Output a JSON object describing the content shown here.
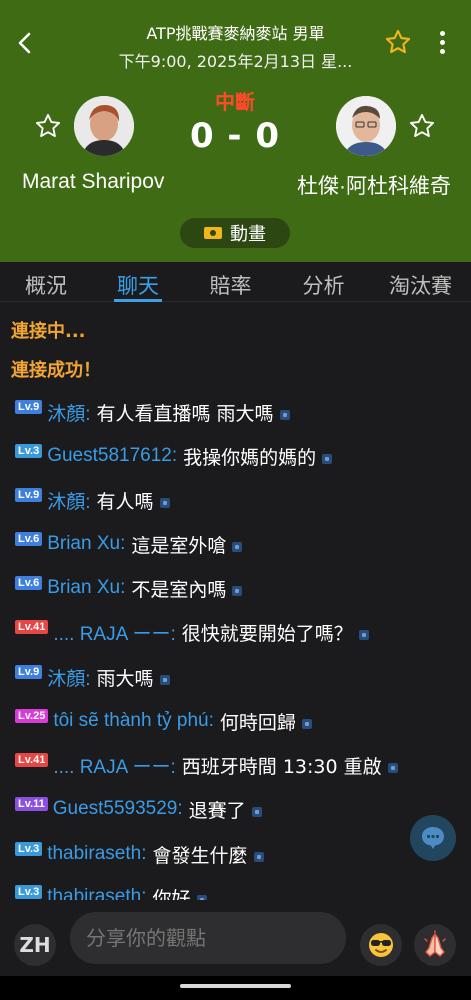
{
  "header": {
    "title": "ATP挑戰賽麥納麥站 男單",
    "subtitle": "下午9:00, 2025年2月13日 星...",
    "status": "中斷",
    "score": "0 - 0",
    "animation_label": "動畫",
    "home_player": "Marat Sharipov",
    "away_player": "杜傑·阿杜科維奇"
  },
  "tabs": [
    {
      "label": "概況"
    },
    {
      "label": "聊天"
    },
    {
      "label": "賠率"
    },
    {
      "label": "分析"
    },
    {
      "label": "淘汰賽"
    }
  ],
  "chat": {
    "system": [
      "連接中...",
      "連接成功！"
    ],
    "messages": [
      {
        "level": "Lv.9",
        "user": "沐顏:",
        "text": "有人看直播嗎 雨大嗎"
      },
      {
        "level": "Lv.3",
        "user": "Guest5817612:",
        "text": "我操你媽的媽的"
      },
      {
        "level": "Lv.9",
        "user": "沐顏:",
        "text": "有人嗎"
      },
      {
        "level": "Lv.6",
        "user": "Brian Xu:",
        "text": "這是室外嗆"
      },
      {
        "level": "Lv.6",
        "user": "Brian Xu:",
        "text": "不是室內嗎"
      },
      {
        "level": "Lv.41",
        "user": ".... RAJA ーー:",
        "text": "很快就要開始了嗎？"
      },
      {
        "level": "Lv.9",
        "user": "沐顏:",
        "text": "雨大嗎"
      },
      {
        "level": "Lv.25",
        "user": "tôi sẽ thành tỷ phú:",
        "text": "何時回歸"
      },
      {
        "level": "Lv.41",
        "user": ".... RAJA ーー:",
        "text": "西班牙時間 13:30 重啟"
      },
      {
        "level": "Lv.11",
        "user": "Guest5593529:",
        "text": "退賽了"
      },
      {
        "level": "Lv.3",
        "user": "thabiraseth:",
        "text": "會發生什麼"
      },
      {
        "level": "Lv.3",
        "user": "thabiraseth:",
        "text": "你好"
      }
    ]
  },
  "bottom": {
    "lang": "ZH",
    "input_placeholder": "分享你的觀點"
  },
  "colors": {
    "header_bg": "#3e6b13",
    "accent": "#3aa0ea",
    "status": "#ff4a2a",
    "system_text": "#f2a534",
    "lv_blue": "#3f7fe0",
    "lv_red": "#e84545",
    "lv_magenta": "#d93bd9",
    "lv_purple": "#8d4fe0",
    "lv_light_blue": "#3a9ad9"
  }
}
